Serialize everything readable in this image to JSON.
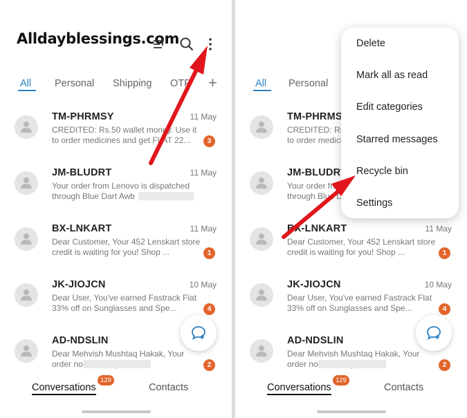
{
  "watermark": "Alldayblessings.com",
  "tabs": [
    {
      "label": "All"
    },
    {
      "label": "Personal"
    },
    {
      "label": "Shipping"
    },
    {
      "label": "OTP"
    }
  ],
  "conversations": [
    {
      "sender": "TM-PHRMSY",
      "date": "11 May",
      "preview": "CREDITED: Rs.50 wallet money. Use it to order medicines and get FLAT 22...",
      "badge": "3"
    },
    {
      "sender": "JM-BLUDRT",
      "date": "11 May",
      "preview": "Your order from Lenovo is dispatched through Blue Dart Awb",
      "badge": ""
    },
    {
      "sender": "BX-LNKART",
      "date": "11 May",
      "preview": "Dear Customer, Your 452 Lenskart store credit is waiting for you! Shop ...",
      "badge": "1"
    },
    {
      "sender": "JK-JIOJCN",
      "date": "10 May",
      "preview": "Dear User,  You've earned Fastrack Flat 33% off on Sunglasses and Spe...",
      "badge": "4"
    },
    {
      "sender": "AD-NDSLIN",
      "date": "",
      "preview": "Dear Mehvish Mushtaq Hakak, Your order no. 46 ready for s",
      "badge": "2"
    }
  ],
  "bottom_nav": {
    "conversations_label": "Conversations",
    "conversations_count": "129",
    "contacts_label": "Contacts"
  },
  "menu": {
    "items": [
      {
        "label": "Delete"
      },
      {
        "label": "Mark all as read"
      },
      {
        "label": "Edit categories"
      },
      {
        "label": "Starred messages"
      },
      {
        "label": "Recycle bin"
      },
      {
        "label": "Settings"
      }
    ]
  },
  "colors": {
    "accent": "#2a7fc0",
    "badge": "#e2642c",
    "arrow": "#e0161c"
  },
  "icons": [
    "filter-icon",
    "search-icon",
    "more-options-icon",
    "add-tab-icon",
    "person-icon",
    "new-message-icon"
  ]
}
